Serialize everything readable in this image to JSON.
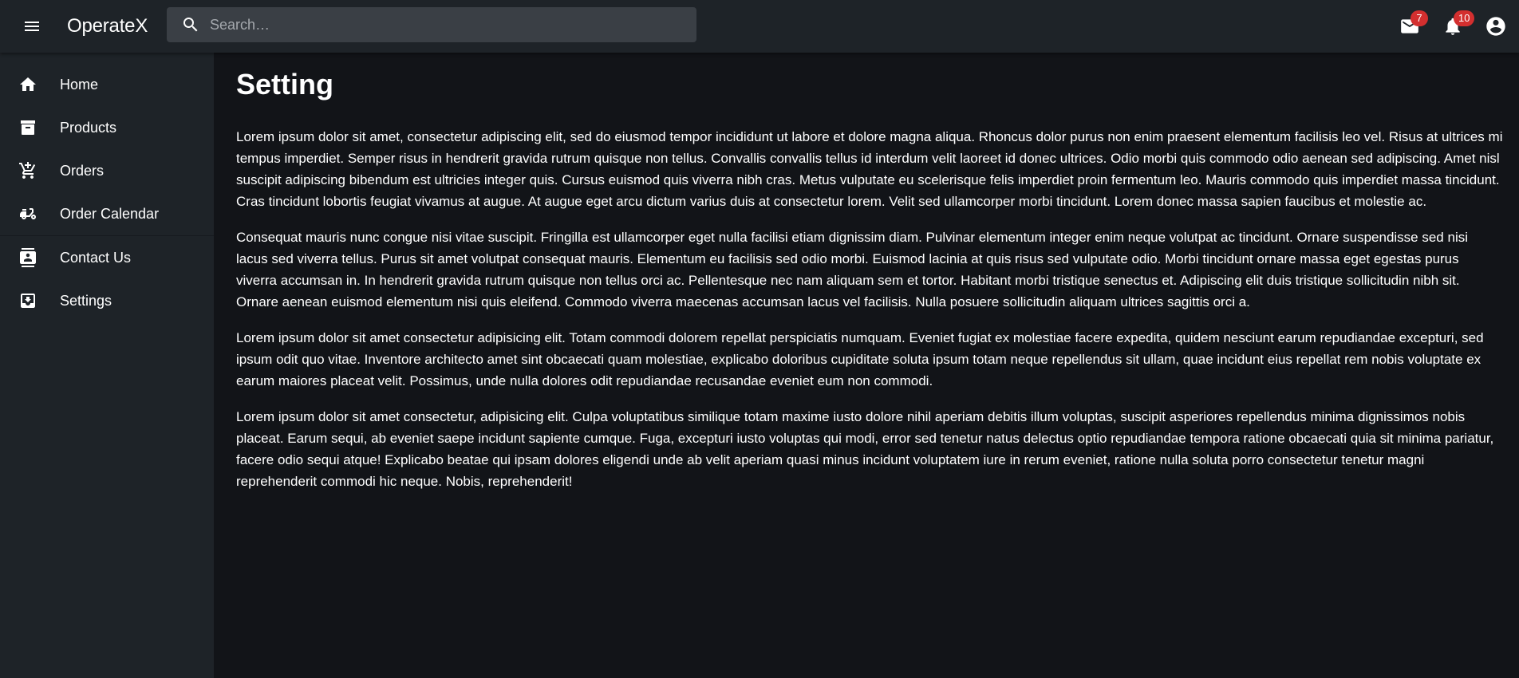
{
  "app": {
    "title": "OperateX"
  },
  "search": {
    "placeholder": "Search…"
  },
  "header": {
    "mail_count": "7",
    "notification_count": "10"
  },
  "sidebar": {
    "items": [
      {
        "label": "Home",
        "icon": "home-icon"
      },
      {
        "label": "Products",
        "icon": "archive-icon"
      },
      {
        "label": "Orders",
        "icon": "cart-icon"
      },
      {
        "label": "Order Calendar",
        "icon": "scooter-icon"
      },
      {
        "label": "Contact Us",
        "icon": "contact-card-icon"
      },
      {
        "label": "Settings",
        "icon": "settings-box-icon"
      }
    ]
  },
  "main": {
    "title": "Setting",
    "paragraphs": [
      "Lorem ipsum dolor sit amet, consectetur adipiscing elit, sed do eiusmod tempor incididunt ut labore et dolore magna aliqua. Rhoncus dolor purus non enim praesent elementum facilisis leo vel. Risus at ultrices mi tempus imperdiet. Semper risus in hendrerit gravida rutrum quisque non tellus. Convallis convallis tellus id interdum velit laoreet id donec ultrices. Odio morbi quis commodo odio aenean sed adipiscing. Amet nisl suscipit adipiscing bibendum est ultricies integer quis. Cursus euismod quis viverra nibh cras. Metus vulputate eu scelerisque felis imperdiet proin fermentum leo. Mauris commodo quis imperdiet massa tincidunt. Cras tincidunt lobortis feugiat vivamus at augue. At augue eget arcu dictum varius duis at consectetur lorem. Velit sed ullamcorper morbi tincidunt. Lorem donec massa sapien faucibus et molestie ac.",
      "Consequat mauris nunc congue nisi vitae suscipit. Fringilla est ullamcorper eget nulla facilisi etiam dignissim diam. Pulvinar elementum integer enim neque volutpat ac tincidunt. Ornare suspendisse sed nisi lacus sed viverra tellus. Purus sit amet volutpat consequat mauris. Elementum eu facilisis sed odio morbi. Euismod lacinia at quis risus sed vulputate odio. Morbi tincidunt ornare massa eget egestas purus viverra accumsan in. In hendrerit gravida rutrum quisque non tellus orci ac. Pellentesque nec nam aliquam sem et tortor. Habitant morbi tristique senectus et. Adipiscing elit duis tristique sollicitudin nibh sit. Ornare aenean euismod elementum nisi quis eleifend. Commodo viverra maecenas accumsan lacus vel facilisis. Nulla posuere sollicitudin aliquam ultrices sagittis orci a.",
      "Lorem ipsum dolor sit amet consectetur adipisicing elit. Totam commodi dolorem repellat perspiciatis numquam. Eveniet fugiat ex molestiae facere expedita, quidem nesciunt earum repudiandae excepturi, sed ipsum odit quo vitae. Inventore architecto amet sint obcaecati quam molestiae, explicabo doloribus cupiditate soluta ipsum totam neque repellendus sit ullam, quae incidunt eius repellat rem nobis voluptate ex earum maiores placeat velit. Possimus, unde nulla dolores odit repudiandae recusandae eveniet eum non commodi.",
      "Lorem ipsum dolor sit amet consectetur, adipisicing elit. Culpa voluptatibus similique totam maxime iusto dolore nihil aperiam debitis illum voluptas, suscipit asperiores repellendus minima dignissimos nobis placeat. Earum sequi, ab eveniet saepe incidunt sapiente cumque. Fuga, excepturi iusto voluptas qui modi, error sed tenetur natus delectus optio repudiandae tempora ratione obcaecati quia sit minima pariatur, facere odio sequi atque! Explicabo beatae qui ipsam dolores eligendi unde ab velit aperiam quasi minus incidunt voluptatem iure in rerum eveniet, ratione nulla soluta porro consectetur tenetur magni reprehenderit commodi hic neque. Nobis, reprehenderit!"
    ]
  },
  "colors": {
    "appbar_bg": "#1e2328",
    "sidebar_bg": "#1e2328",
    "main_bg": "#121418",
    "badge": "#d32f2f",
    "search_bg": "#3a3f45"
  }
}
